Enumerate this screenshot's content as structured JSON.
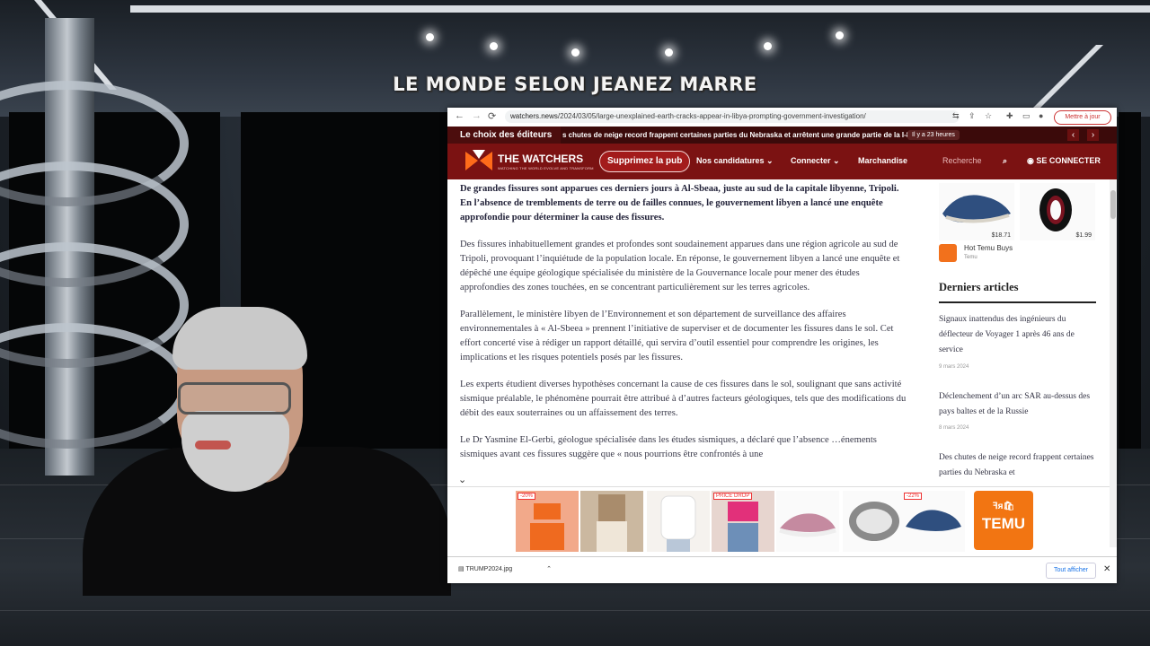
{
  "show": {
    "title": "LE MONDE SELON JEANEZ MARRE"
  },
  "browser": {
    "url_domain": "watchers.news",
    "url_path": "/2024/03/05/large-unexplained-earth-cracks-appear-in-libya-prompting-government-investigation/",
    "update_label": "Mettre à jour",
    "back_icon": "←",
    "forward_icon": "→",
    "reload_icon": "⟳"
  },
  "ticker": {
    "label": "Le choix des éditeurs",
    "message": "s chutes de neige record frappent certaines parties du Nebraska et arrêtent une grande partie de la I-80",
    "time": "Il y a 23 heures",
    "prev": "‹",
    "next": "›"
  },
  "site": {
    "logo": "THE WATCHERS",
    "logo_sub": "WATCHING THE WORLD EVOLVE AND TRANSFORM",
    "ads_button": "Supprimez la pub",
    "nav": [
      "Nos candidatures",
      "Connecter",
      "Marchandise"
    ],
    "search_placeholder": "Recherche",
    "login": "SE CONNECTER",
    "accent": "#7b1212"
  },
  "article": {
    "paragraphs": [
      "De grandes fissures sont apparues ces derniers jours à Al-Sbeaa, juste au sud de la capitale libyenne, Tripoli. En l’absence de tremblements de terre ou de failles connues, le gouvernement libyen a lancé une enquête approfondie pour déterminer la cause des fissures.",
      "Des fissures inhabituellement grandes et profondes sont soudainement apparues dans une région agricole au sud de Tripoli, provoquant l’inquiétude de la population locale. En réponse, le gouvernement libyen a lancé une enquête et dépêché une équipe géologique spécialisée du ministère de la Gouvernance locale pour mener des études approfondies des zones touchées, en se concentrant particulièrement sur les terres agricoles.",
      "Parallèlement, le ministère libyen de l’Environnement et son département de surveillance des affaires environnementales à « Al-Sbeea » prennent l’initiative de superviser et de documenter les fissures dans le sol. Cet effort concerté vise à rédiger un rapport détaillé, qui servira d’outil essentiel pour comprendre les origines, les implications et les risques potentiels posés par les fissures.",
      "Les experts étudient diverses hypothèses concernant la cause de ces fissures dans le sol, soulignant que sans activité sismique préalable, le phénomène pourrait être attribué à d’autres facteurs géologiques, tels que des modifications du débit des eaux souterraines ou un affaissement des terres.",
      "Le Dr Yasmine El-Gerbi, géologue spécialisée dans les études sismiques, a déclaré que l’absence …énements sismiques avant ces fissures suggère que « nous pourrions être confrontés à une"
    ]
  },
  "sidebar": {
    "prices": [
      "$18.71",
      "$1.99"
    ],
    "sponsor": "Hot Temu Buys",
    "sponsor_sub": "Temu",
    "heading": "Derniers articles",
    "articles": [
      {
        "title": "Signaux inattendus des ingénieurs du déflecteur de Voyager 1 après 46 ans de service",
        "date": "9 mars 2024"
      },
      {
        "title": "Déclenchement d’un arc SAR au-dessus des pays baltes et de la Russie",
        "date": "8 mars 2024"
      },
      {
        "title": "Des chutes de neige record frappent certaines parties du Nebraska et",
        "date": ""
      }
    ]
  },
  "ad_strip": {
    "badges": [
      "-20%",
      "PRICE DROP",
      "-22%"
    ],
    "temu_label": "TEMU",
    "temu_glyphs": "ꟻᴙ🛍",
    "collapse": "⌄"
  },
  "download": {
    "file": "TRUMP2024.jpg",
    "show_all": "Tout afficher",
    "close": "✕"
  }
}
